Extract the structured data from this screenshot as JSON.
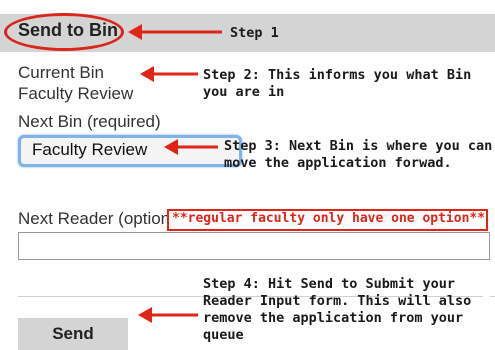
{
  "header": {
    "title": "Send to Bin"
  },
  "fields": {
    "current_bin_label": "Current Bin",
    "current_bin_value": "Faculty Review",
    "next_bin_label": "Next Bin (required)",
    "next_bin_selected": "Faculty Review",
    "next_reader_label": "Next Reader (optional)",
    "next_reader_value": ""
  },
  "actions": {
    "send_label": "Send"
  },
  "annotations": {
    "step1": "Step 1",
    "step2_line1": "Step 2: This informs you what Bin",
    "step2_line2": "you are in",
    "step3_line1": "Step 3: Next Bin is where you can",
    "step3_line2": "move the application forwad.",
    "note": "**regular faculty only have one option**",
    "step4_line1": "Step 4: Hit Send to Submit your",
    "step4_line2": "Reader Input form.  This will also",
    "step4_line3": "remove the application from your",
    "step4_line4": "queue"
  },
  "colors": {
    "annotation_red": "#e02418",
    "focus_blue": "#7fb3ea",
    "header_gray": "#d4d4d4"
  }
}
